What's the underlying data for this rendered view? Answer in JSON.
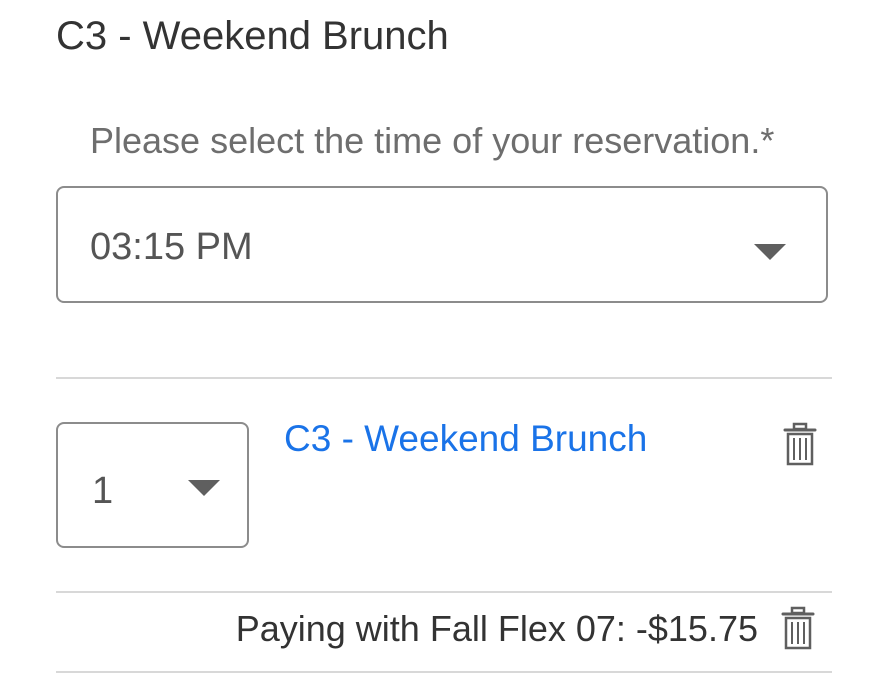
{
  "header": {
    "title": "C3 - Weekend Brunch"
  },
  "reservation": {
    "prompt": "Please select the time of your reservation.*",
    "selected_time": "03:15 PM"
  },
  "cart": {
    "items": [
      {
        "quantity": "1",
        "name": "C3 - Weekend Brunch",
        "payment": "Paying with Fall Flex 07: -$15.75"
      }
    ]
  },
  "icons": {
    "dropdown": "chevron-down-icon",
    "delete": "trash-icon"
  },
  "colors": {
    "link": "#1a73e8",
    "text": "#333333",
    "muted": "#6e6e6e",
    "border": "#8c8c8c",
    "divider": "#d8d8d8"
  }
}
